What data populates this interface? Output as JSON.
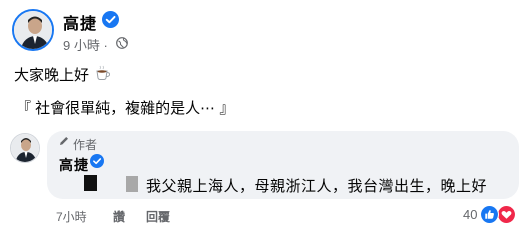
{
  "post": {
    "author": "高捷",
    "time": "9 小時 ·",
    "line1": "大家晚上好",
    "line2": "『 社會很單純，複雜的是人⋯ 』"
  },
  "comment": {
    "badge": "作者",
    "author": "高捷",
    "text": "我父親上海人，母親浙江人，我台灣出生，晚上好",
    "time": "7小時",
    "read_label": "讚",
    "reply_label": "回覆",
    "reaction_count": "40"
  },
  "colors": {
    "verified": "#1877f2",
    "like": "#1877f2",
    "love": "#f0284a",
    "secondary_text": "#65676b",
    "bubble": "#f0f2f5"
  },
  "icons": [
    "verified-icon",
    "globe-icon",
    "coffee-icon",
    "pencil-icon",
    "like-icon",
    "love-icon"
  ]
}
